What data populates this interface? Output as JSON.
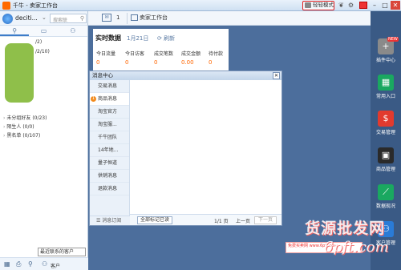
{
  "window": {
    "title": "千牛 - 卖家工作台",
    "light_mode_label": "轻轻模式"
  },
  "user": {
    "name": "deciti..."
  },
  "search": {
    "placeholder": "搜索联"
  },
  "topstrip": {
    "msg_count": "1",
    "workspace_label": "卖家工作台"
  },
  "contacts": {
    "groups": [
      {
        "label": "/2)"
      },
      {
        "label": "/2/10)"
      },
      {
        "label": "未分组好友 (0/23)"
      },
      {
        "label": "陌生人 (0/0)"
      },
      {
        "label": "黑名单 (0/107)"
      }
    ],
    "tooltip": "最近联系的客户",
    "bottom_label": "客户"
  },
  "realtime": {
    "title": "实时数据",
    "date": "1月21日",
    "refresh": "刷新",
    "metrics": [
      {
        "label": "今日流量",
        "value": "0"
      },
      {
        "label": "今日访客",
        "value": "0"
      },
      {
        "label": "成交笔数",
        "value": "0"
      },
      {
        "label": "成交金额",
        "value": "0.00"
      },
      {
        "label": "待付款",
        "value": "0"
      }
    ]
  },
  "message_center": {
    "title": "消息中心",
    "items": [
      {
        "label": "交易消息"
      },
      {
        "label": "商品消息",
        "badge": "1"
      },
      {
        "label": "淘宝官方"
      },
      {
        "label": "淘宝服..."
      },
      {
        "label": "千牛团队"
      },
      {
        "label": "14年地..."
      },
      {
        "label": "量子恒道"
      },
      {
        "label": "供销消息"
      },
      {
        "label": "退款消息"
      }
    ],
    "subscribe": "消息订阅",
    "mark_all_read": "全部标记已读",
    "page": "1/1 页",
    "prev": "上一页",
    "next": "下一页"
  },
  "rightbar": {
    "new_badge": "NEW",
    "items": [
      {
        "label": "插件中心",
        "icon": "plus-icon",
        "color": "#8a8a8a"
      },
      {
        "label": "常用入口",
        "icon": "grid-icon",
        "color": "#1aa860"
      },
      {
        "label": "交易管理",
        "icon": "money-icon",
        "color": "#e23a2e"
      },
      {
        "label": "商品管理",
        "icon": "bag-icon",
        "color": "#2a2a2a"
      },
      {
        "label": "数据现况",
        "icon": "chart-icon",
        "color": "#1aa860"
      },
      {
        "label": "客户管理",
        "icon": "user-icon",
        "color": "#2a7bd6"
      }
    ]
  },
  "promo": {
    "text": "免费买卖网 www.6pft.com"
  },
  "watermark": {
    "line1": "货源批发网",
    "line2": "6pft.com"
  }
}
